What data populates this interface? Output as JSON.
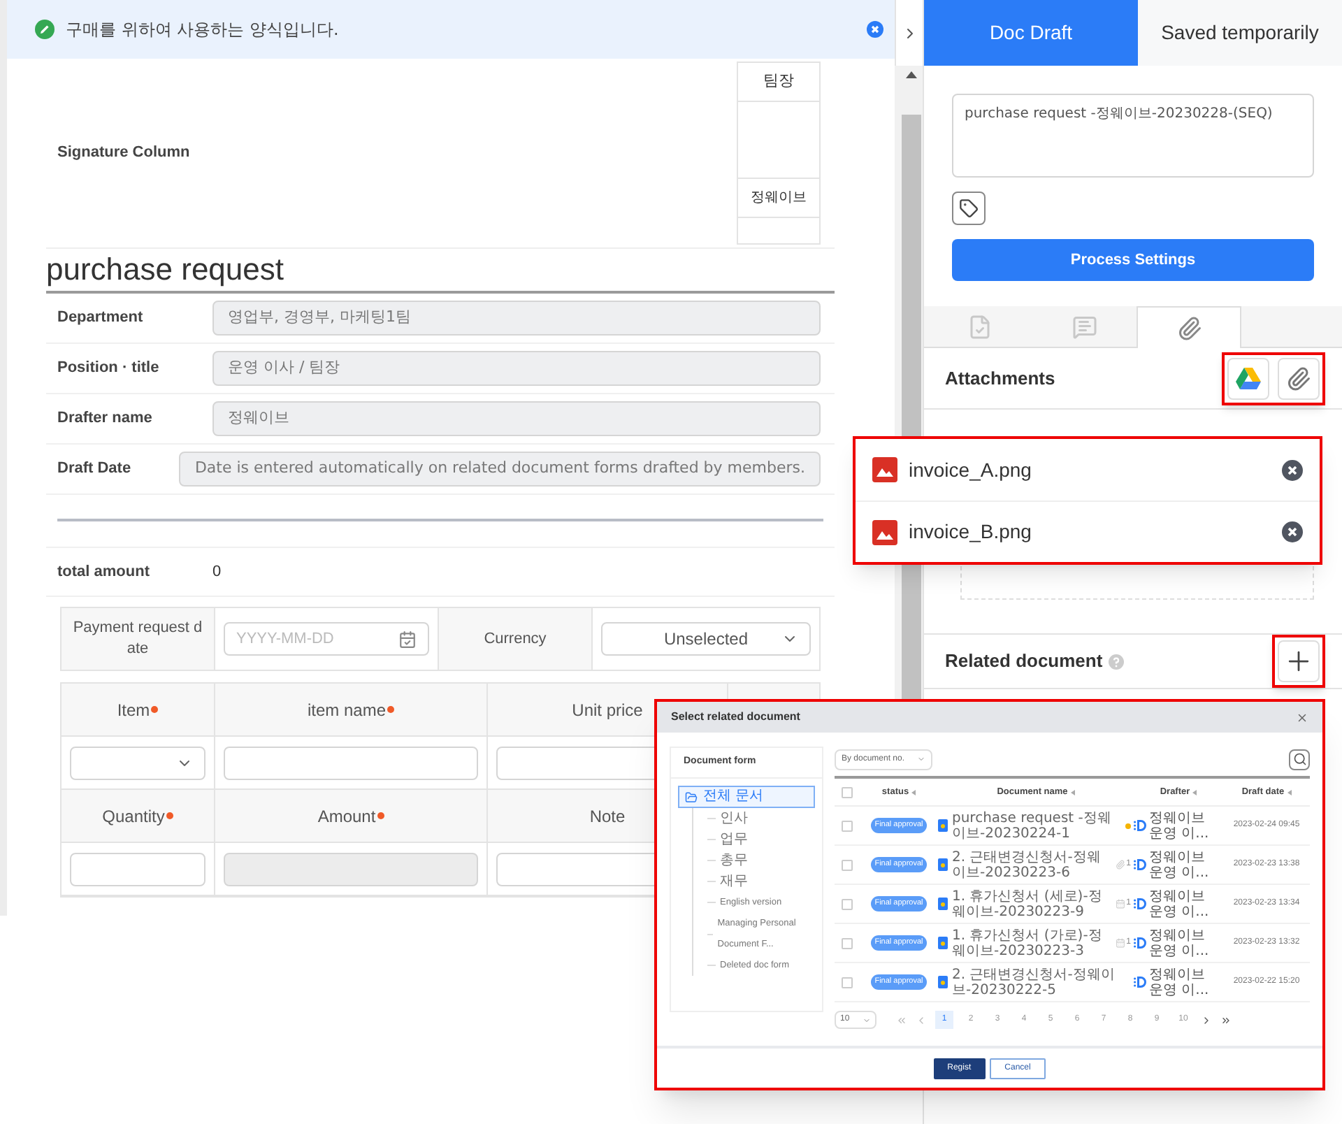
{
  "notice": {
    "text": "구매를 위하여 사용하는 양식입니다."
  },
  "signature": {
    "label": "Signature Column",
    "approver_title": "팀장",
    "approver_name": "정웨이브"
  },
  "form": {
    "title": "purchase request",
    "fields": [
      {
        "label": "Department",
        "value": "영업부, 경영부, 마케팅1팀",
        "disabled": true
      },
      {
        "label": "Position · title",
        "value": "운영 이사 / 팀장",
        "disabled": true
      },
      {
        "label": "Drafter name",
        "value": "정웨이브",
        "disabled": true
      },
      {
        "label": "Draft Date",
        "value": "Date is entered automatically on related document forms drafted by members.",
        "disabled": true
      }
    ],
    "total": {
      "label": "total amount",
      "value": "0"
    },
    "payment": {
      "date_label": "Payment request date",
      "date_placeholder": "YYYY-MM-DD",
      "currency_label": "Currency",
      "currency_value": "Unselected"
    },
    "item_rows": [
      {
        "headers": [
          {
            "label": "Item",
            "required": true
          },
          {
            "label": "item name",
            "required": true
          },
          {
            "label": "Unit price",
            "required": false
          }
        ],
        "inputs": [
          {
            "kind": "select"
          },
          {
            "kind": "text"
          },
          {
            "kind": "text"
          }
        ]
      },
      {
        "headers": [
          {
            "label": "Quantity",
            "required": true
          },
          {
            "label": "Amount",
            "required": true
          },
          {
            "label": "Note",
            "required": false
          }
        ],
        "inputs": [
          {
            "kind": "text"
          },
          {
            "kind": "readonly"
          },
          {
            "kind": "text"
          }
        ]
      }
    ]
  },
  "side": {
    "tabs": [
      {
        "label": "Doc Draft",
        "selected": true
      },
      {
        "label": "Saved temporarily",
        "selected": false
      }
    ],
    "title_value": "purchase request -정웨이브-20230228-(SEQ)",
    "process_button": "Process Settings",
    "panel_tabs": [
      {
        "kind": "approval",
        "selected": false
      },
      {
        "kind": "comment",
        "selected": false
      },
      {
        "kind": "attachment",
        "selected": true
      }
    ],
    "attachments_title": "Attachments",
    "files": [
      {
        "name": "invoice_A.png"
      },
      {
        "name": "invoice_B.png"
      }
    ],
    "related_title": "Related document"
  },
  "dialog": {
    "title": "Select related document",
    "tree_title": "Document form",
    "tree": [
      {
        "label": "전체 문서",
        "selected": true,
        "children": [
          {
            "label": "인사",
            "selected": false
          },
          {
            "label": "업무",
            "selected": false
          },
          {
            "label": "총무",
            "selected": false
          },
          {
            "label": "재무",
            "selected": false
          },
          {
            "label": "English version",
            "selected": false
          },
          {
            "label": "Managing Personal Document F...",
            "selected": false
          },
          {
            "label": "Deleted doc form",
            "selected": false
          }
        ]
      }
    ],
    "sort": "By document no.",
    "select_all_checked": false,
    "columns": [
      "status",
      "Document name",
      "Drafter",
      "Draft date"
    ],
    "rows": [
      {
        "checked": false,
        "status": "Final approval",
        "name": "purchase request -정웨이브-20230224-1",
        "extra": {
          "kind": "dot"
        },
        "drafter": "정웨이브 운영 이...",
        "date": "2023-02-24 09:45"
      },
      {
        "checked": false,
        "status": "Final approval",
        "name": "2. 근태변경신청서-정웨이브-20230223-6",
        "extra": {
          "kind": "clip",
          "count": "1"
        },
        "drafter": "정웨이브 운영 이...",
        "date": "2023-02-23 13:38"
      },
      {
        "checked": false,
        "status": "Final approval",
        "name": "1. 휴가신청서 (세로)-정웨이브-20230223-9",
        "extra": {
          "kind": "calendar",
          "count": "1"
        },
        "drafter": "정웨이브 운영 이...",
        "date": "2023-02-23 13:34"
      },
      {
        "checked": false,
        "status": "Final approval",
        "name": "1. 휴가신청서 (가로)-정웨이브-20230223-3",
        "extra": {
          "kind": "calendar",
          "count": "1"
        },
        "drafter": "정웨이브 운영 이...",
        "date": "2023-02-23 13:32"
      },
      {
        "checked": false,
        "status": "Final approval",
        "name": "2. 근태변경신청서-정웨이브-20230222-5",
        "drafter": "정웨이브 운영 이...",
        "date": "2023-02-22 15:20"
      }
    ],
    "page_size": "10",
    "pages": [
      {
        "label": "1",
        "selected": true
      },
      {
        "label": "2",
        "selected": false
      },
      {
        "label": "3",
        "selected": false
      },
      {
        "label": "4",
        "selected": false
      },
      {
        "label": "5",
        "selected": false
      },
      {
        "label": "6",
        "selected": false
      },
      {
        "label": "7",
        "selected": false
      },
      {
        "label": "8",
        "selected": false
      },
      {
        "label": "9",
        "selected": false
      },
      {
        "label": "10",
        "selected": false
      }
    ],
    "buttons": [
      {
        "label": "Regist",
        "kind": "primary"
      },
      {
        "label": "Cancel",
        "kind": "secondary"
      }
    ]
  }
}
